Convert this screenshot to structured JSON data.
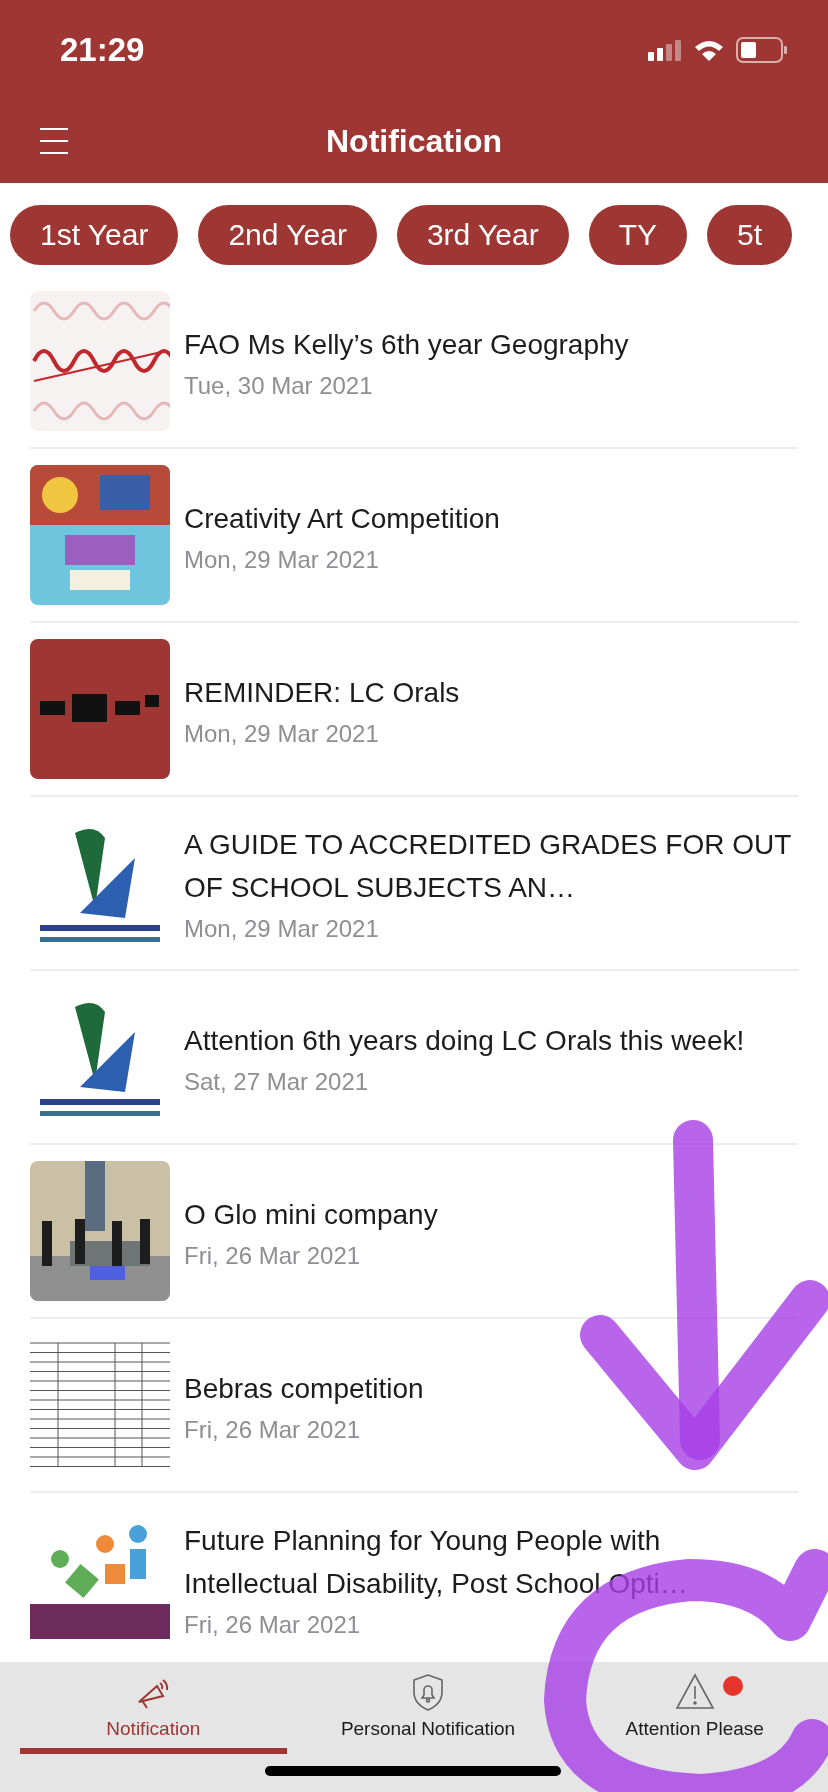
{
  "status_bar": {
    "time": "21:29"
  },
  "nav_bar": {
    "title": "Notification"
  },
  "year_filters": [
    {
      "label": "1st Year"
    },
    {
      "label": "2nd Year"
    },
    {
      "label": "3rd Year"
    },
    {
      "label": "TY"
    },
    {
      "label": "5t"
    }
  ],
  "notifications": [
    {
      "title": "FAO Ms Kelly’s 6th year Geography",
      "date": "Tue, 30 Mar 2021"
    },
    {
      "title": "Creativity Art Competition",
      "date": "Mon, 29 Mar 2021"
    },
    {
      "title": "REMINDER: LC Orals",
      "date": "Mon, 29 Mar 2021"
    },
    {
      "title": "A GUIDE TO ACCREDITED GRADES FOR OUT OF SCHOOL SUBJECTS AN…",
      "date": "Mon, 29 Mar 2021"
    },
    {
      "title": "Attention 6th years doing LC Orals this week!",
      "date": "Sat, 27 Mar 2021"
    },
    {
      "title": "O Glo mini company",
      "date": "Fri, 26 Mar 2021"
    },
    {
      "title": "Bebras competition",
      "date": "Fri, 26 Mar 2021"
    },
    {
      "title": "Future Planning for Young People with Intellectual Disability, Post School Opti…",
      "date": "Fri, 26 Mar 2021"
    }
  ],
  "tab_bar": [
    {
      "label": "Notification",
      "selected": true,
      "badge": false
    },
    {
      "label": "Personal Notification",
      "selected": false,
      "badge": false
    },
    {
      "label": "Attention Please",
      "selected": false,
      "badge": true
    }
  ],
  "annotations": [
    {
      "kind": "arrow"
    },
    {
      "kind": "circle"
    }
  ]
}
